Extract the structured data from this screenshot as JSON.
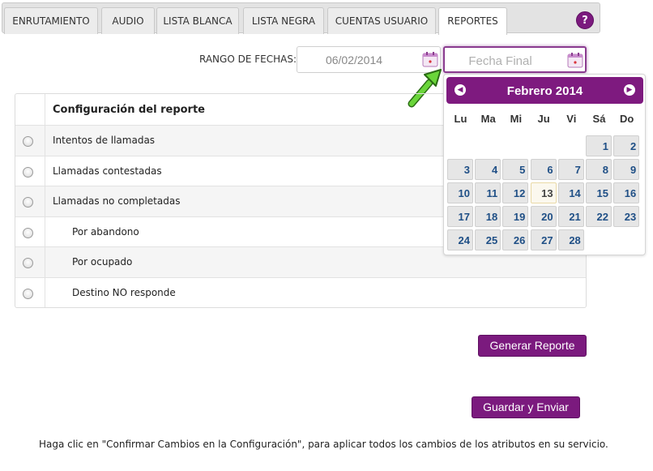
{
  "tabs": [
    {
      "label": "ENRUTAMIENTO"
    },
    {
      "label": "AUDIO"
    },
    {
      "label": "LISTA BLANCA"
    },
    {
      "label": "LISTA NEGRA"
    },
    {
      "label": "CUENTAS USUARIO"
    },
    {
      "label": "REPORTES",
      "active": true
    }
  ],
  "help": {
    "label": "?"
  },
  "date_range": {
    "label": "RANGO DE FECHAS:",
    "start_value": "06/02/2014",
    "end_placeholder": "Fecha Final"
  },
  "table": {
    "header": "Configuración del reporte",
    "rows": [
      {
        "label": "Intentos de llamadas"
      },
      {
        "label": "Llamadas contestadas"
      },
      {
        "label": "Llamadas no completadas"
      },
      {
        "label": "Por abandono"
      },
      {
        "label": "Por ocupado"
      },
      {
        "label": "Destino NO responde"
      }
    ]
  },
  "calendar": {
    "title": "Febrero 2014",
    "prev": "◀",
    "next": "▶",
    "weekdays": [
      "Lu",
      "Ma",
      "Mi",
      "Ju",
      "Vi",
      "Sá",
      "Do"
    ],
    "weeks": [
      [
        "",
        "",
        "",
        "",
        "",
        "1",
        "2"
      ],
      [
        "3",
        "4",
        "5",
        "6",
        "7",
        "8",
        "9"
      ],
      [
        "10",
        "11",
        "12",
        "13",
        "14",
        "15",
        "16"
      ],
      [
        "17",
        "18",
        "19",
        "20",
        "21",
        "22",
        "23"
      ],
      [
        "24",
        "25",
        "26",
        "27",
        "28",
        "",
        ""
      ]
    ],
    "today": "13"
  },
  "buttons": {
    "generate": "Generar Reporte",
    "save": "Guardar y Enviar"
  },
  "footer_note": "Haga clic en \"Confirmar Cambios en la Configuración\", para aplicar todos los cambios de los atributos en su servicio.",
  "colors": {
    "accent": "#7b1a7e",
    "arrow": "#6ad53a"
  }
}
